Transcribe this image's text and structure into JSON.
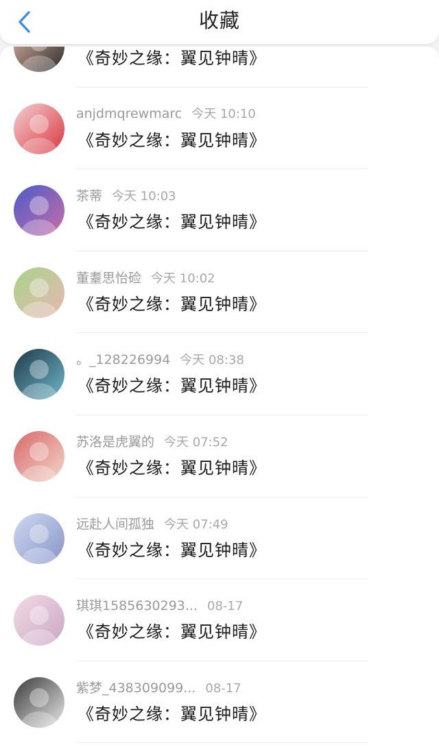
{
  "header": {
    "title": "收藏",
    "back_icon": "chevron-left-icon",
    "accent": "#3a8df0"
  },
  "items": [
    {
      "user": "",
      "time": "",
      "title": "《奇妙之缘：翼见钟晴》",
      "avatar_colors": [
        "#e6b9a7",
        "#2b2b2b"
      ]
    },
    {
      "user": "anjdmqrewmarc",
      "time": "今天 10:10",
      "title": "《奇妙之缘：翼见钟晴》",
      "avatar_colors": [
        "#f4cfd2",
        "#d9363e"
      ]
    },
    {
      "user": "茶蒂",
      "time": "今天 10:03",
      "title": "《奇妙之缘：翼见钟晴》",
      "avatar_colors": [
        "#4c5cc9",
        "#c86da8"
      ]
    },
    {
      "user": "董耋思怡硷",
      "time": "今天 10:02",
      "title": "《奇妙之缘：翼见钟晴》",
      "avatar_colors": [
        "#a6d48a",
        "#e9b7b3"
      ]
    },
    {
      "user": "。_128226994",
      "time": "今天 08:38",
      "title": "《奇妙之缘：翼见钟晴》",
      "avatar_colors": [
        "#1e3a48",
        "#6fb6c9"
      ]
    },
    {
      "user": "苏洛是虎翼的",
      "time": "今天 07:52",
      "title": "《奇妙之缘：翼见钟晴》",
      "avatar_colors": [
        "#d9686a",
        "#f2d6c8"
      ]
    },
    {
      "user": "远赴人间孤独",
      "time": "今天 07:49",
      "title": "《奇妙之缘：翼见钟晴》",
      "avatar_colors": [
        "#cfd8ef",
        "#8795c7"
      ]
    },
    {
      "user": "琪琪1585630293...",
      "time": "08-17",
      "title": "《奇妙之缘：翼见钟晴》",
      "avatar_colors": [
        "#f3dbe5",
        "#c9a6c4"
      ]
    },
    {
      "user": "紫梦_438309099...",
      "time": "08-17",
      "title": "《奇妙之缘：翼见钟晴》",
      "avatar_colors": [
        "#3a3a3a",
        "#e8e8e8"
      ]
    }
  ]
}
